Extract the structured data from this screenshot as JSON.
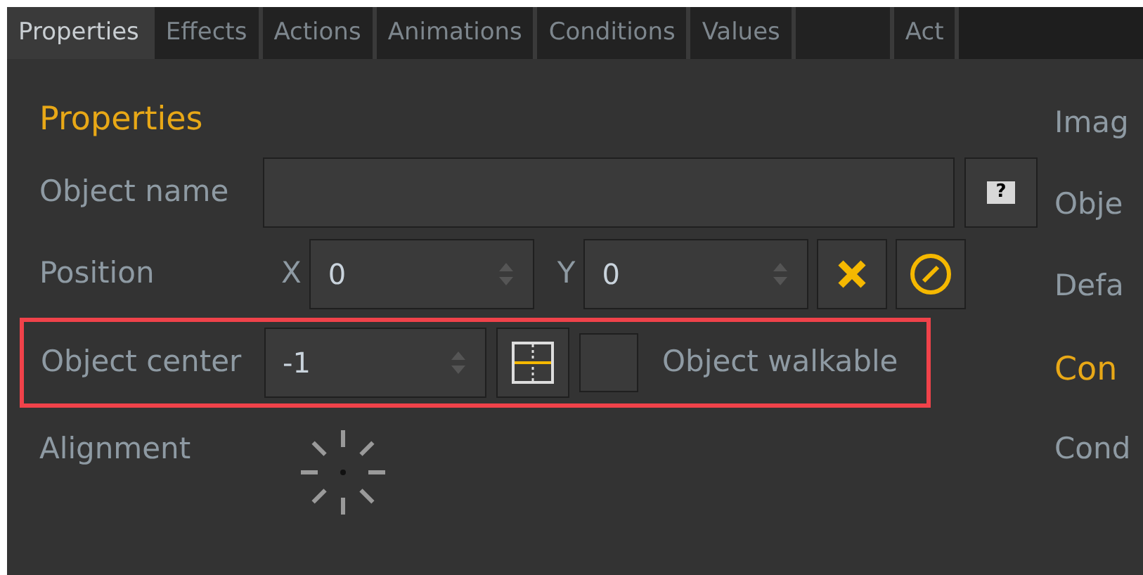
{
  "tabs": [
    {
      "kind": "text",
      "label": "Properties",
      "selected": true
    },
    {
      "kind": "text",
      "label": "Effects",
      "selected": false
    },
    {
      "kind": "text",
      "label": "Actions",
      "selected": false
    },
    {
      "kind": "text",
      "label": "Animations",
      "selected": false
    },
    {
      "kind": "text",
      "label": "Conditions",
      "selected": false
    },
    {
      "kind": "text",
      "label": "Values",
      "selected": false
    },
    {
      "kind": "blank",
      "selected": false
    },
    {
      "kind": "text",
      "label": "Act",
      "selected": false
    }
  ],
  "properties": {
    "heading": "Properties",
    "object_name": {
      "label": "Object name",
      "value_help": "?"
    },
    "position": {
      "label": "Position",
      "x_label": "X",
      "x_value": "0",
      "y_label": "Y",
      "y_value": "0"
    },
    "object_center": {
      "label": "Object center",
      "value": "-1",
      "highlighted": true,
      "walkable": {
        "label": "Object walkable",
        "checked": false
      }
    },
    "alignment": {
      "label": "Alignment"
    }
  },
  "right_column": {
    "rows": [
      {
        "kind": "label",
        "text": "Imag"
      },
      {
        "kind": "label",
        "text": "Obje"
      },
      {
        "kind": "label",
        "text": "Defa"
      },
      {
        "kind": "heading",
        "text": "Con"
      },
      {
        "kind": "label",
        "text": "Cond"
      }
    ]
  }
}
